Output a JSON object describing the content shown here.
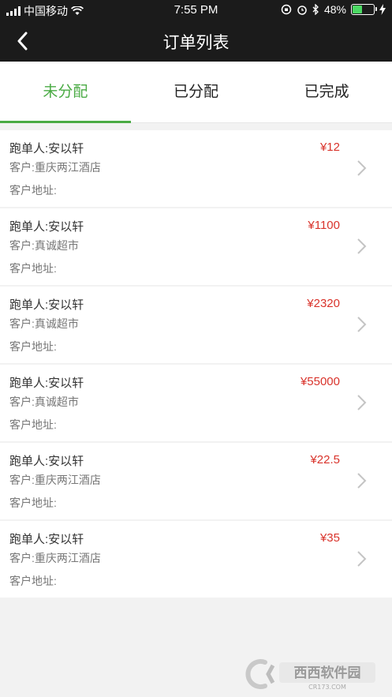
{
  "status_bar": {
    "carrier": "中国移动",
    "time": "7:55 PM",
    "battery": "48%",
    "battery_level": 0.48
  },
  "nav": {
    "title": "订单列表"
  },
  "tabs": [
    {
      "label": "未分配",
      "active": true
    },
    {
      "label": "已分配",
      "active": false
    },
    {
      "label": "已完成",
      "active": false
    }
  ],
  "orders": [
    {
      "runner": "跑单人:安以轩",
      "customer": "客户:重庆两江酒店",
      "address": "客户地址:",
      "price": "¥12"
    },
    {
      "runner": "跑单人:安以轩",
      "customer": "客户:真诚超市",
      "address": "客户地址:",
      "price": "¥1100"
    },
    {
      "runner": "跑单人:安以轩",
      "customer": "客户:真诚超市",
      "address": "客户地址:",
      "price": "¥2320"
    },
    {
      "runner": "跑单人:安以轩",
      "customer": "客户:真诚超市",
      "address": "客户地址:",
      "price": "¥55000"
    },
    {
      "runner": "跑单人:安以轩",
      "customer": "客户:重庆两江酒店",
      "address": "客户地址:",
      "price": "¥22.5"
    },
    {
      "runner": "跑单人:安以轩",
      "customer": "客户:重庆两江酒店",
      "address": "客户地址:",
      "price": "¥35"
    }
  ],
  "watermark": {
    "text": "西西软件园",
    "sub": "CR173.COM"
  },
  "colors": {
    "accent": "#4aab44",
    "price": "#d9332b",
    "topbar": "#1b1b1b"
  }
}
